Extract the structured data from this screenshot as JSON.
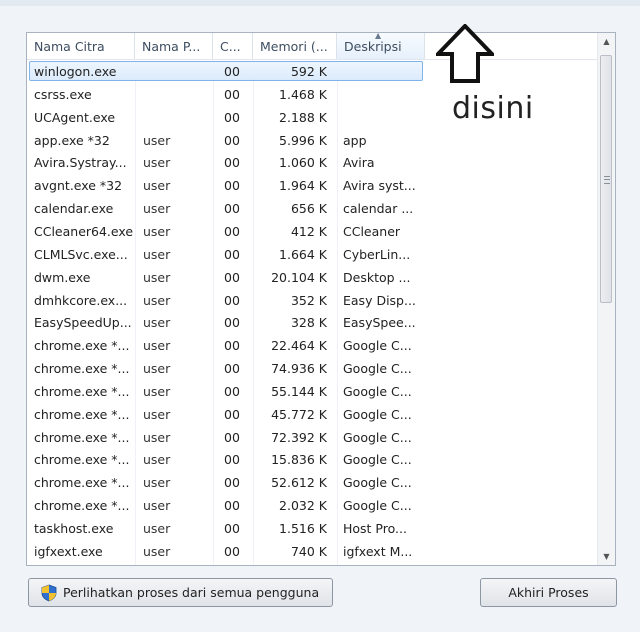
{
  "columns": {
    "image_name": "Nama Citra",
    "user_name": "Nama P...",
    "cpu": "C...",
    "memory": "Memori (...",
    "description": "Deskripsi"
  },
  "processes": [
    {
      "name": "winlogon.exe",
      "user": "",
      "cpu": "00",
      "memory": "592 K",
      "description": ""
    },
    {
      "name": "csrss.exe",
      "user": "",
      "cpu": "00",
      "memory": "1.468 K",
      "description": ""
    },
    {
      "name": "UCAgent.exe",
      "user": "",
      "cpu": "00",
      "memory": "2.188 K",
      "description": ""
    },
    {
      "name": "app.exe *32",
      "user": "user",
      "cpu": "00",
      "memory": "5.996 K",
      "description": "app"
    },
    {
      "name": "Avira.Systray...",
      "user": "user",
      "cpu": "00",
      "memory": "1.060 K",
      "description": "Avira"
    },
    {
      "name": "avgnt.exe *32",
      "user": "user",
      "cpu": "00",
      "memory": "1.964 K",
      "description": "Avira syst..."
    },
    {
      "name": "calendar.exe",
      "user": "user",
      "cpu": "00",
      "memory": "656 K",
      "description": "calendar ..."
    },
    {
      "name": "CCleaner64.exe",
      "user": "user",
      "cpu": "00",
      "memory": "412 K",
      "description": "CCleaner"
    },
    {
      "name": "CLMLSvc.exe...",
      "user": "user",
      "cpu": "00",
      "memory": "1.664 K",
      "description": "CyberLin..."
    },
    {
      "name": "dwm.exe",
      "user": "user",
      "cpu": "00",
      "memory": "20.104 K",
      "description": "Desktop ..."
    },
    {
      "name": "dmhkcore.ex...",
      "user": "user",
      "cpu": "00",
      "memory": "352 K",
      "description": "Easy Disp..."
    },
    {
      "name": "EasySpeedUp...",
      "user": "user",
      "cpu": "00",
      "memory": "328 K",
      "description": "EasySpee..."
    },
    {
      "name": "chrome.exe *...",
      "user": "user",
      "cpu": "00",
      "memory": "22.464 K",
      "description": "Google C..."
    },
    {
      "name": "chrome.exe *...",
      "user": "user",
      "cpu": "00",
      "memory": "74.936 K",
      "description": "Google C..."
    },
    {
      "name": "chrome.exe *...",
      "user": "user",
      "cpu": "00",
      "memory": "55.144 K",
      "description": "Google C..."
    },
    {
      "name": "chrome.exe *...",
      "user": "user",
      "cpu": "00",
      "memory": "45.772 K",
      "description": "Google C..."
    },
    {
      "name": "chrome.exe *...",
      "user": "user",
      "cpu": "00",
      "memory": "72.392 K",
      "description": "Google C..."
    },
    {
      "name": "chrome.exe *...",
      "user": "user",
      "cpu": "00",
      "memory": "15.836 K",
      "description": "Google C..."
    },
    {
      "name": "chrome.exe *...",
      "user": "user",
      "cpu": "00",
      "memory": "52.612 K",
      "description": "Google C..."
    },
    {
      "name": "chrome.exe *...",
      "user": "user",
      "cpu": "00",
      "memory": "2.032 K",
      "description": "Google C..."
    },
    {
      "name": "taskhost.exe",
      "user": "user",
      "cpu": "00",
      "memory": "1.516 K",
      "description": "Host Pro..."
    },
    {
      "name": "igfxext.exe",
      "user": "user",
      "cpu": "00",
      "memory": "740 K",
      "description": "igfxext M..."
    }
  ],
  "annotation": {
    "label": "disini"
  },
  "buttons": {
    "show_all": "Perlihatkan proses dari semua pengguna",
    "end_process": "Akhiri Proses"
  },
  "colors": {
    "selection": "#dcebfc",
    "selection_border": "#7eb4ea"
  }
}
